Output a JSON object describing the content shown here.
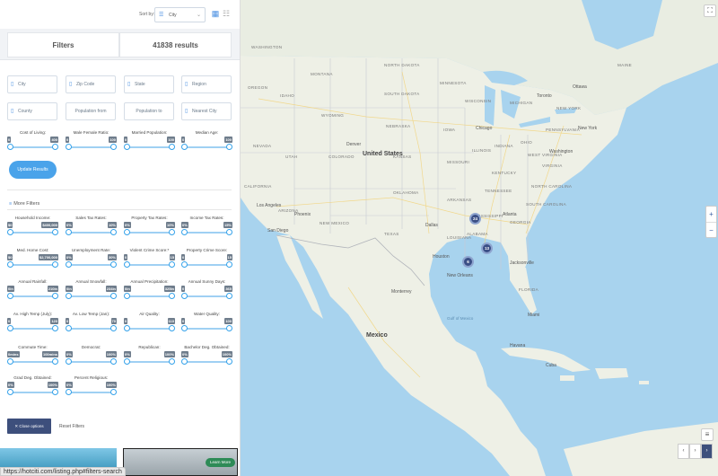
{
  "sort": {
    "label": "Sort by:",
    "value": "City"
  },
  "tabs": {
    "filters": "Filters",
    "results": "41838 results"
  },
  "fields": {
    "city": "City",
    "zip": "Zip Code",
    "state": "State",
    "region": "Region",
    "county": "County",
    "pop_from": "Population from",
    "pop_to": "Population to",
    "nearest": "Nearest City"
  },
  "sliders": [
    {
      "title": "Cost of Living:",
      "min": "0",
      "max": "400"
    },
    {
      "title": "Male Female Ratio:",
      "min": "0",
      "max": "100"
    },
    {
      "title": "Married Population:",
      "min": "0",
      "max": "100"
    },
    {
      "title": "Median Age:",
      "min": "0",
      "max": "100"
    },
    {
      "title": "Household Income:",
      "min": "$0",
      "max": "$400,000"
    },
    {
      "title": "Sales Tax Rates:",
      "min": "0%",
      "max": "10%"
    },
    {
      "title": "Property Tax Rates:",
      "min": "0%",
      "max": "10%"
    },
    {
      "title": "Income Tax Rates:",
      "min": "0%",
      "max": "15%"
    },
    {
      "title": "Med. Home Cost:",
      "min": "$0",
      "max": "$2,700,000"
    },
    {
      "title": "Unemployment Rate:",
      "min": "0%",
      "max": "30%"
    },
    {
      "title": "Violent Crime Score:*",
      "min": "0",
      "max": "15"
    },
    {
      "title": "Property Crime Score:",
      "min": "0",
      "max": "15"
    },
    {
      "title": "Annual Rainfall:",
      "min": "0in",
      "max": "210in"
    },
    {
      "title": "Annual Snowfall:",
      "min": "0in",
      "max": "234in"
    },
    {
      "title": "Annual Precipitation:",
      "min": "0in",
      "max": "325in"
    },
    {
      "title": "Annual Sunny Days:",
      "min": "0",
      "max": "365"
    },
    {
      "title": "Av. High Temp (July):",
      "min": "0",
      "max": "120"
    },
    {
      "title": "Av. Low Temp (Jan):",
      "min": "0",
      "max": "70"
    },
    {
      "title": "Air Quality:",
      "min": "0",
      "max": "110"
    },
    {
      "title": "Water Quality:",
      "min": "0",
      "max": "100"
    },
    {
      "title": "Commute Time:",
      "min": "0mins",
      "max": "100mins"
    },
    {
      "title": "Democrat:",
      "min": "0%",
      "max": "100%"
    },
    {
      "title": "Republican:",
      "min": "0%",
      "max": "100%"
    },
    {
      "title": "Bachelor Deg. Obtained:",
      "min": "0%",
      "max": "100%"
    },
    {
      "title": "Grad Deg. Obtained:",
      "min": "0%",
      "max": "100%"
    },
    {
      "title": "Percent Religious:",
      "min": "0%",
      "max": "100%"
    }
  ],
  "buttons": {
    "update": "Update Results",
    "more": "More Filters",
    "close": "Close options",
    "reset": "Reset Filters",
    "learn": "Learn More"
  },
  "status_url": "https://hotciti.com/listing.php#filters-search",
  "map": {
    "country_labels": {
      "us": "United States",
      "mexico": "Mexico"
    },
    "states": {
      "nd": "NORTH DAKOTA",
      "sd": "SOUTH DAKOTA",
      "ne": "NEBRASKA",
      "ks": "KANSAS",
      "ok": "OKLAHOMA",
      "tx": "TEXAS",
      "nm": "NEW MEXICO",
      "az": "ARIZONA",
      "co": "COLORADO",
      "wy": "WYOMING",
      "mt": "MONTANA",
      "ut": "UTAH",
      "nv": "NEVADA",
      "ca": "CALIFORNIA",
      "or": "OREGON",
      "wa": "WASHINGTON",
      "id": "IDAHO",
      "mn": "MINNESOTA",
      "ia": "IOWA",
      "mo": "MISSOURI",
      "ar": "ARKANSAS",
      "la": "LOUISIANA",
      "ms": "MISSISSIPPI",
      "al": "ALABAMA",
      "ga": "GEORGIA",
      "fl": "FLORIDA",
      "tn": "TENNESSEE",
      "ky": "KENTUCKY",
      "il": "ILLINOIS",
      "wi": "WISCONSIN",
      "mi": "MICHIGAN",
      "in": "INDIANA",
      "oh": "OHIO",
      "pa": "PENNSYLVANIA",
      "ny": "NEW YORK",
      "va": "VIRGINIA",
      "nc": "NORTH CAROLINA",
      "sc": "SOUTH CAROLINA",
      "wv": "WEST VIRGINIA",
      "me": "MAINE"
    },
    "cities": {
      "chicago": "Chicago",
      "dallas": "Dallas",
      "houston": "Houston",
      "neworleans": "New Orleans",
      "atlanta": "Atlanta",
      "miami": "Miami",
      "nyc": "New York",
      "washington": "Washington",
      "toronto": "Toronto",
      "denver": "Denver",
      "losangeles": "Los Angeles",
      "sandiego": "San Diego",
      "phoenix": "Phoenix",
      "monterrey": "Monterrey",
      "havana": "Havana",
      "cuba": "Cuba",
      "gulf": "Gulf of Mexico",
      "ottawa": "Ottawa",
      "jacksonville": "Jacksonville"
    },
    "clusters": [
      "24",
      "13",
      "6"
    ],
    "fullscreen_icon": "fullscreen-icon",
    "zoom_in": "+",
    "zoom_out": "−",
    "nav": {
      "prev": "‹",
      "next": "›",
      "menu": "≡"
    }
  }
}
